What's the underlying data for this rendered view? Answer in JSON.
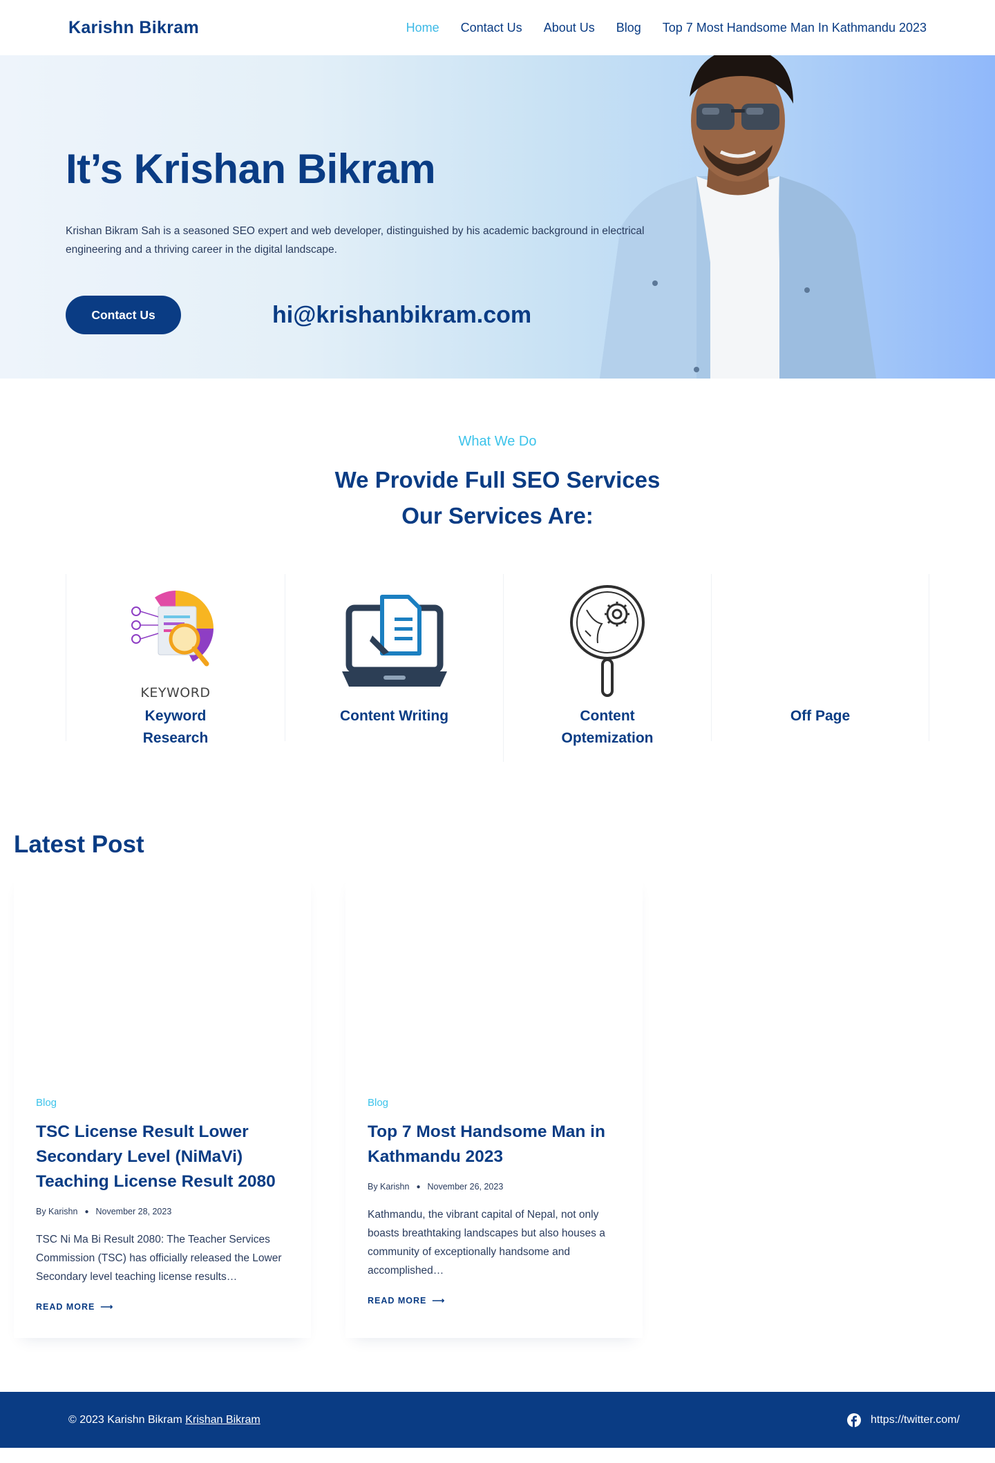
{
  "header": {
    "brand": "Karishn Bikram",
    "nav": [
      "Home",
      "Contact Us",
      "About Us",
      "Blog",
      "Top 7 Most Handsome Man In Kathmandu 2023"
    ]
  },
  "hero": {
    "title": "It’s Krishan Bikram",
    "description": "Krishan Bikram Sah is a seasoned SEO expert and web developer, distinguished by his academic background in electrical engineering and a thriving career in the digital landscape.",
    "cta_label": "Contact Us",
    "email": "hi@krishanbikram.com"
  },
  "services": {
    "eyebrow": "What We Do",
    "title_line1": "We Provide Full SEO Services",
    "title_line2": "Our Services Are:",
    "items": [
      {
        "name": "Keyword Research",
        "icon": "keyword-research-icon",
        "icon_caption": "KEYWORD"
      },
      {
        "name": "Content Writing",
        "icon": "laptop-document-icon"
      },
      {
        "name": "Content Optemization",
        "icon": "search-gear-icon"
      },
      {
        "name": "Off Page",
        "icon": ""
      }
    ]
  },
  "latest": {
    "title": "Latest Post",
    "posts": [
      {
        "category": "Blog",
        "title": "TSC License Result Lower Secondary Level (NiMaVi) Teaching License Result 2080",
        "author": "By Karishn",
        "date": "November 28, 2023",
        "excerpt": "TSC Ni Ma Bi Result 2080: The Teacher Services Commission (TSC) has officially released the Lower Secondary level teaching license results…",
        "read_more": "READ MORE"
      },
      {
        "category": "Blog",
        "title": "Top 7 Most Handsome Man in Kathmandu 2023",
        "author": "By Karishn",
        "date": "November 26, 2023",
        "excerpt": "Kathmandu, the vibrant capital of Nepal, not only boasts breathtaking landscapes but also houses a community of exceptionally handsome and accomplished…",
        "read_more": "READ MORE"
      }
    ]
  },
  "footer": {
    "copyright": "© 2023 Karishn Bikram",
    "link": "Krishan Bikram",
    "social_text": "https://twitter.com/"
  },
  "colors": {
    "primary": "#0a3c84",
    "accent": "#3cc3ea",
    "footer_bg": "#0a3c84"
  }
}
